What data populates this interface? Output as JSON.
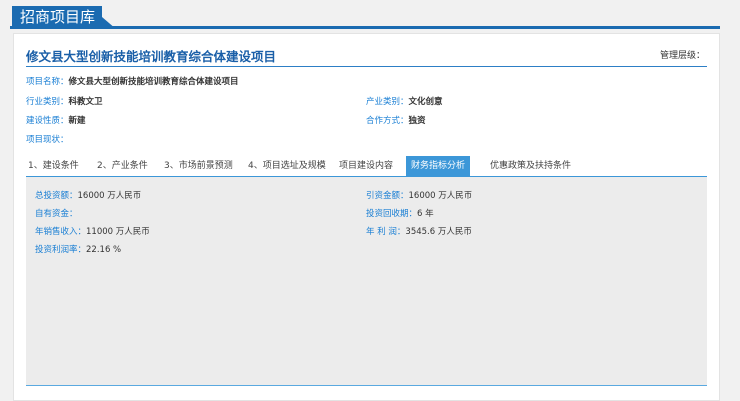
{
  "header": {
    "title": "招商项目库"
  },
  "project": {
    "title": "修文县大型创新技能培训教育综合体建设项目",
    "manage_label": "管理层级："
  },
  "fields": {
    "name": {
      "label": "项目名称：",
      "value": "修文县大型创新技能培训教育综合体建设项目"
    },
    "industry": {
      "label": "行业类别：",
      "value": "科教文卫"
    },
    "product": {
      "label": "产业类别：",
      "value": "文化创意"
    },
    "nature": {
      "label": "建设性质：",
      "value": "新建"
    },
    "coop": {
      "label": "合作方式：",
      "value": "独资"
    },
    "status": {
      "label": "项目现状：",
      "value": ""
    }
  },
  "tabs": [
    {
      "label": "1、建设条件"
    },
    {
      "label": "2、产业条件"
    },
    {
      "label": "3、市场前景预测"
    },
    {
      "label": "4、项目选址及规模"
    },
    {
      "label": "项目建设内容"
    },
    {
      "label": "财务指标分析"
    },
    {
      "label": "优惠政策及扶持条件"
    }
  ],
  "finance": {
    "total": {
      "label": "总投资额：",
      "value": "16000 万人民币"
    },
    "attract": {
      "label": "引资金额：",
      "value": "16000 万人民币"
    },
    "self": {
      "label": "自有资金：",
      "value": ""
    },
    "payback": {
      "label": "投资回收期：",
      "value": "6 年"
    },
    "sales": {
      "label": "年销售收入：",
      "value": "11000 万人民币"
    },
    "profit": {
      "label": "年 利 润：",
      "value": "3545.6 万人民币"
    },
    "rate": {
      "label": "投资利润率：",
      "value": "22.16 %"
    }
  },
  "colors": {
    "accent": "#1b6bb1",
    "label": "#1a7fd4",
    "tab_active": "#3c97d8"
  }
}
